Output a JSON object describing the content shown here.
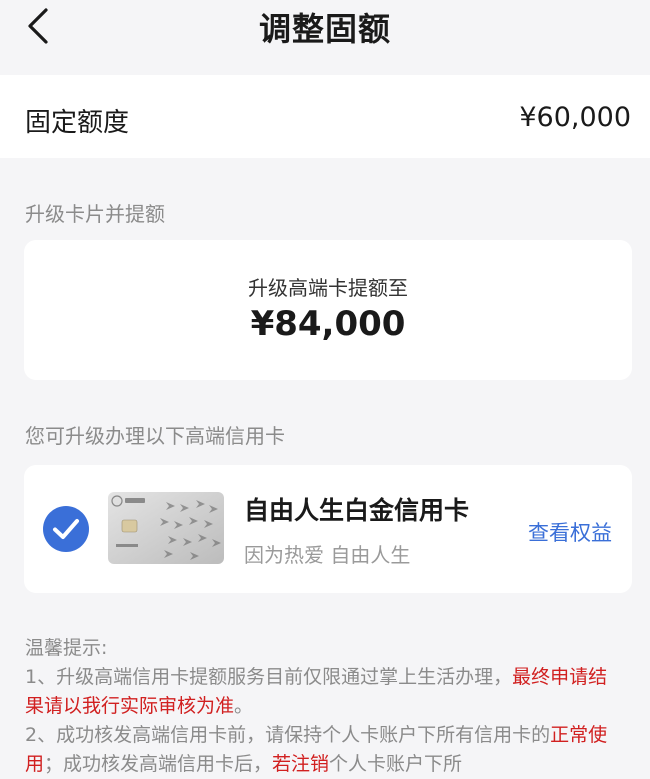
{
  "header": {
    "title": "调整固额"
  },
  "fixed_limit": {
    "label": "固定额度",
    "value": "¥60,000"
  },
  "upgrade_section": {
    "heading": "升级卡片并提额",
    "card_text": "升级高端卡提额至",
    "card_amount": "¥84,000"
  },
  "options_section": {
    "heading": "您可升级办理以下高端信用卡",
    "card": {
      "name": "自由人生白金信用卡",
      "slogan": "因为热爱 自由人生",
      "link": "查看权益",
      "selected": true
    }
  },
  "tips": {
    "title": "温馨提示:",
    "item1_normal": "1、升级高端信用卡提额服务目前仅限通过掌上生活办理，",
    "item1_red": "最终申请结果请以我行实际审核为准",
    "item1_end": "。",
    "item2_a": "2、成功核发高端信用卡前，请保持个人卡账户下所有信用卡的",
    "item2_red1": "正常使用",
    "item2_b": "；成功核发高端信用卡后，",
    "item2_red2": "若注销",
    "item2_c": "个人卡账户下所"
  },
  "colors": {
    "accent": "#3a6fd8",
    "warning": "#d12020",
    "background": "#f5f5f7"
  }
}
